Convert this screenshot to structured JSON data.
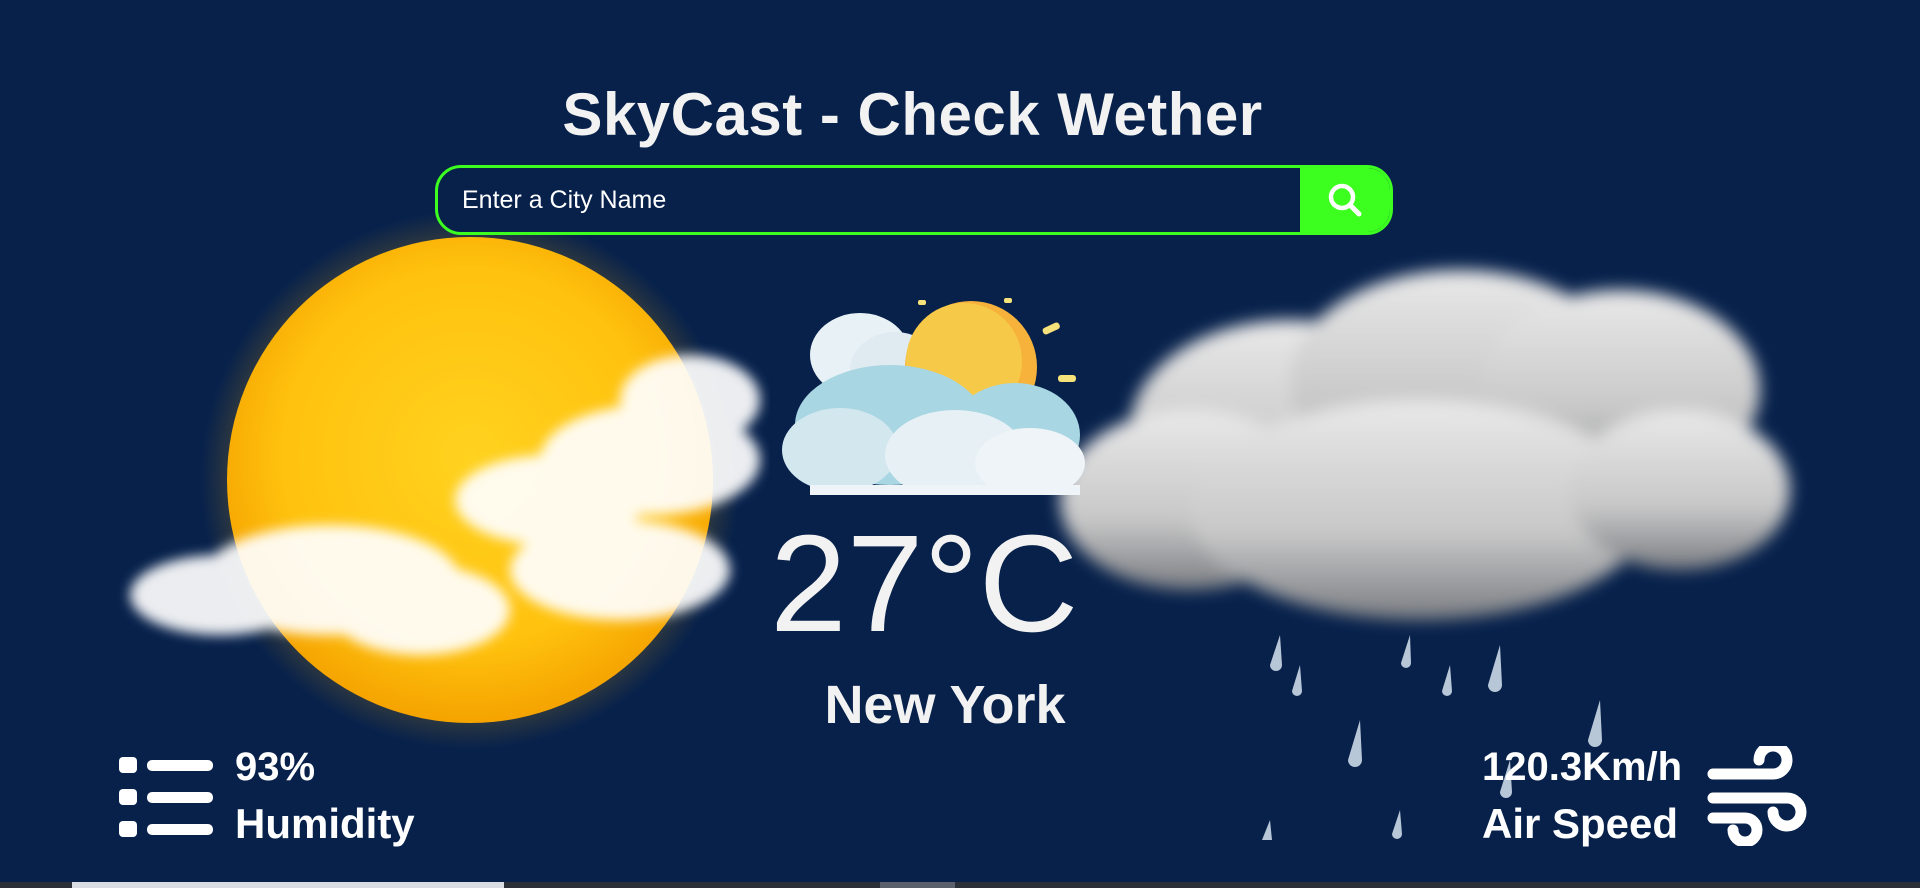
{
  "header": {
    "title": "SkyCast - Check Wether"
  },
  "search": {
    "placeholder": "Enter a City Name",
    "button_icon": "search-icon"
  },
  "weather": {
    "temperature": "27°C",
    "city": "New York",
    "condition_icon": "partly-cloudy-icon"
  },
  "stats": {
    "humidity": {
      "value": "93%",
      "label": "Humidity",
      "icon": "list-icon"
    },
    "wind": {
      "value": "120.3Km/h",
      "label": "Air Speed",
      "icon": "wind-icon"
    }
  },
  "colors": {
    "background": "#07214b",
    "accent": "#3cff20",
    "text": "#ffffff"
  }
}
